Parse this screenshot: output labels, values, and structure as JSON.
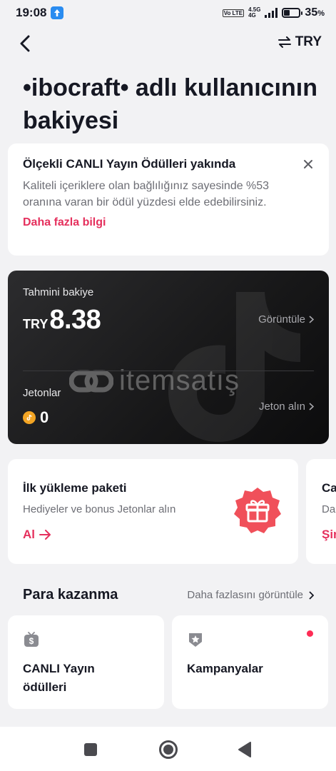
{
  "status_bar": {
    "time": "19:08",
    "network_type": "4.5G",
    "network_sub": "4G",
    "volte": "Vo LTE",
    "battery_percent": "35",
    "battery_unit": "%"
  },
  "nav": {
    "currency_label": "TRY"
  },
  "page_title": "•ibocraft• adlı kullanıcının bakiyesi",
  "notice": {
    "title": "Ölçekli CANLI Yayın Ödülleri yakında",
    "body": "Kaliteli içeriklere olan bağlılığınız sayesinde %53 oranına varan bir ödül yüzdesi elde edebilirsiniz.",
    "link": "Daha fazla bilgi"
  },
  "balance": {
    "estimated_label": "Tahmini bakiye",
    "currency": "TRY",
    "amount": "8.38",
    "view_link": "Görüntüle",
    "coins_label": "Jetonlar",
    "coins_value": "0",
    "get_coins_link": "Jeton alın",
    "watermark": "itemsatış"
  },
  "promo": {
    "title": "İlk yükleme paketi",
    "subtitle": "Hediyeler ve bonus Jetonlar alın",
    "action": "Al",
    "next_title": "Ca",
    "next_subtitle": "Da",
    "next_action": "Şir"
  },
  "earn": {
    "section_title": "Para kazanma",
    "more_link": "Daha fazlasını görüntüle",
    "cards": [
      {
        "label": "CANLI Yayın ödülleri",
        "icon": "tv-dollar-icon"
      },
      {
        "label": "Kampanyalar",
        "icon": "badge-star-icon",
        "has_dot": true
      }
    ]
  },
  "colors": {
    "accent": "#e5305d",
    "dot": "#fe2c55",
    "background": "#f2f2f4",
    "card_dark": "#171718",
    "coin": "#f3a524"
  }
}
